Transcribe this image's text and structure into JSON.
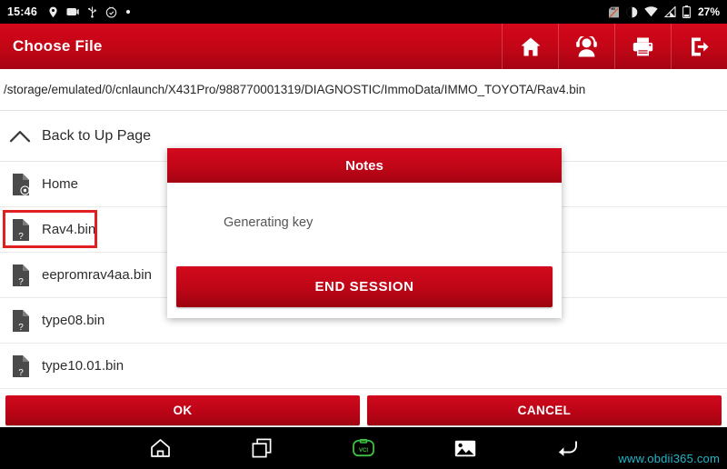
{
  "status_bar": {
    "time": "15:46",
    "battery_percent": "27%",
    "left_icons": [
      "location-pin-icon",
      "cast-screen-icon",
      "usb-icon",
      "screenshot-icon",
      "dot-icon"
    ],
    "right_icons": [
      "sd-card-icon",
      "do-not-disturb-icon",
      "wifi-icon",
      "signal-icon",
      "battery-icon"
    ]
  },
  "app_bar": {
    "title": "Choose File",
    "tools": [
      {
        "name": "home-icon"
      },
      {
        "name": "support-headset-icon"
      },
      {
        "name": "print-icon"
      },
      {
        "name": "exit-icon"
      }
    ]
  },
  "path_bar": {
    "path": "/storage/emulated/0/cnlaunch/X431Pro/988770001319/DIAGNOSTIC/ImmoData/IMMO_TOYOTA/Rav4.bin"
  },
  "back_row": {
    "label": "Back to Up Page",
    "icon": "chevron-up-icon"
  },
  "file_list": {
    "items": [
      {
        "name": "Home",
        "icon": "file-settings-icon",
        "highlighted": false
      },
      {
        "name": "Rav4.bin",
        "icon": "file-unknown-icon",
        "highlighted": true
      },
      {
        "name": "eepromrav4aa.bin",
        "icon": "file-unknown-icon",
        "highlighted": false
      },
      {
        "name": "type08.bin",
        "icon": "file-unknown-icon",
        "highlighted": false
      },
      {
        "name": "type10.01.bin",
        "icon": "file-unknown-icon",
        "highlighted": false
      }
    ]
  },
  "action_bar": {
    "ok_label": "OK",
    "cancel_label": "CANCEL"
  },
  "dialog": {
    "title": "Notes",
    "message": "Generating key",
    "action_label": "END SESSION"
  },
  "nav_bar": {
    "buttons": [
      {
        "name": "nav-home-icon"
      },
      {
        "name": "nav-recents-icon"
      },
      {
        "name": "nav-vci-icon"
      },
      {
        "name": "nav-gallery-icon"
      },
      {
        "name": "nav-back-icon"
      }
    ]
  },
  "watermark": {
    "text": "www.obdii365.com"
  },
  "colors": {
    "brand_red": "#c10616",
    "highlight_red": "#e02020",
    "vci_green": "#3ec13e",
    "watermark_cyan": "#1fb6c9"
  }
}
